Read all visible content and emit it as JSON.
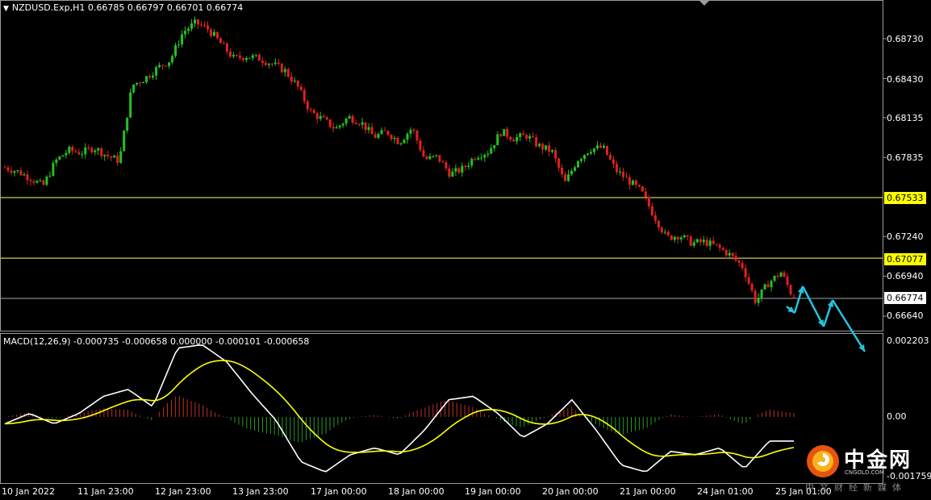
{
  "chart_title": "NZDUSD.Exp,H1  0.66785 0.66797 0.66701 0.66774",
  "macd_title": "MACD(12,26,9) -0.000735 -0.000658 0.000000 -0.000101 -0.000658",
  "colors": {
    "up": "#22c21f",
    "down": "#e02020",
    "signal": "#ffff00",
    "macd_line": "#ffffff",
    "hline": "#ffff66",
    "current": "#9aa6b2",
    "arrow": "#25c4dc"
  },
  "chart_data": [
    {
      "type": "candlestick",
      "symbol": "NZDUSD.Exp",
      "timeframe": "H1",
      "last_ohlc": {
        "open": 0.66785,
        "high": 0.66797,
        "low": 0.66701,
        "close": 0.66774
      },
      "y_ticks": [
        "0.68730",
        "0.68430",
        "0.68135",
        "0.67835",
        "0.67240",
        "0.66940",
        "0.66640"
      ],
      "x_ticks": [
        "10 Jan 2022",
        "11 Jan 23:00",
        "12 Jan 23:00",
        "13 Jan 23:00",
        "17 Jan 00:00",
        "18 Jan 00:00",
        "19 Jan 00:00",
        "20 Jan 00:00",
        "21 Jan 00:00",
        "24 Jan 01:00",
        "25 Jan 01:00"
      ],
      "horizontal_levels": [
        {
          "value": 0.67533,
          "label": "0.67533",
          "style": "yellow"
        },
        {
          "value": 0.67077,
          "label": "0.67077",
          "style": "yellow"
        },
        {
          "value": 0.66774,
          "label": "0.66774",
          "style": "current"
        }
      ],
      "approx_close_path": [
        0.6776,
        0.6773,
        0.6768,
        0.6762,
        0.6781,
        0.6789,
        0.6787,
        0.6791,
        0.6785,
        0.6781,
        0.6838,
        0.6843,
        0.6851,
        0.6857,
        0.6878,
        0.6885,
        0.688,
        0.6869,
        0.6858,
        0.686,
        0.6858,
        0.6854,
        0.6849,
        0.6837,
        0.6818,
        0.6812,
        0.6805,
        0.6814,
        0.681,
        0.6799,
        0.6803,
        0.6795,
        0.6806,
        0.6782,
        0.6784,
        0.6771,
        0.6775,
        0.6785,
        0.6788,
        0.6803,
        0.6798,
        0.68,
        0.6792,
        0.6788,
        0.6764,
        0.6782,
        0.679,
        0.6791,
        0.6774,
        0.6766,
        0.6758,
        0.674,
        0.6723,
        0.6725,
        0.6719,
        0.672,
        0.6716,
        0.671,
        0.6701,
        0.6675,
        0.6689,
        0.6697,
        0.6677
      ],
      "projection_arrows": "price forecast path drawn in cyan",
      "watermark": "中金网 CNGOLD"
    },
    {
      "type": "macd",
      "params": "12,26,9",
      "values": {
        "macd": -0.000735,
        "signal": -0.000658,
        "v3": 0.0,
        "v4": -0.000101,
        "v5": -0.000658
      },
      "y_ticks": [
        "0.002203",
        "0.00",
        "-0.001759"
      ],
      "approx_macd_path": [
        -0.0002,
        0.0001,
        -0.0002,
        0.0001,
        0.0006,
        0.0008,
        0.0003,
        0.002,
        0.0021,
        0.0016,
        0.0007,
        -0.0001,
        -0.0013,
        -0.0016,
        -0.0011,
        -0.0009,
        -0.0011,
        -0.0004,
        0.0005,
        0.0006,
        0.0001,
        -0.0006,
        -0.0002,
        0.0005,
        -0.0004,
        -0.0014,
        -0.0016,
        -0.001,
        -0.0011,
        -0.0009,
        -0.0015,
        -0.0007,
        -0.0007
      ]
    }
  ],
  "watermark": {
    "main": "中金网",
    "sub": "CNGOLD.COM",
    "cn": "中文财经新媒体"
  }
}
